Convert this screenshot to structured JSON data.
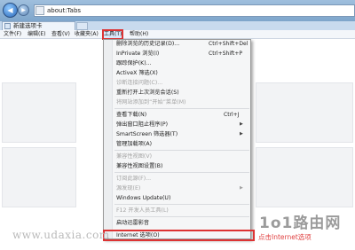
{
  "window": {
    "address": "about:Tabs",
    "tab_label": "新建选项卡"
  },
  "menubar": [
    {
      "label": "文件(F)"
    },
    {
      "label": "编辑(E)"
    },
    {
      "label": "查看(V)"
    },
    {
      "label": "收藏夹(A)"
    },
    {
      "label": "工具(T)",
      "active": true
    },
    {
      "label": "帮助(H)"
    }
  ],
  "tools_menu": {
    "items": [
      {
        "label": "删除浏览的历史记录(D)...",
        "shortcut": "Ctrl+Shift+Del",
        "enabled": true
      },
      {
        "label": "InPrivate 浏览(I)",
        "shortcut": "Ctrl+Shift+P",
        "enabled": true
      },
      {
        "label": "跟踪保护(K)...",
        "enabled": true
      },
      {
        "label": "ActiveX 筛选(X)",
        "enabled": true
      },
      {
        "label": "诊断连接问题(C)...",
        "enabled": false
      },
      {
        "label": "重新打开上次浏览会话(S)",
        "enabled": true
      },
      {
        "label": "将网站添加到“开始”菜单(M)",
        "enabled": false
      },
      {
        "label": "查看下载(N)",
        "shortcut": "Ctrl+J",
        "enabled": true
      },
      {
        "label": "弹出窗口阻止程序(P)",
        "submenu": true,
        "enabled": true
      },
      {
        "label": "SmartScreen 筛选器(T)",
        "submenu": true,
        "enabled": true
      },
      {
        "label": "管理加载项(A)",
        "enabled": true
      },
      {
        "label": "兼容性视图(V)",
        "enabled": false
      },
      {
        "label": "兼容性视图设置(B)",
        "enabled": true
      },
      {
        "label": "订阅此源(F)...",
        "enabled": false
      },
      {
        "label": "源发现(E)",
        "submenu": true,
        "enabled": false
      },
      {
        "label": "Windows Update(U)",
        "enabled": true
      },
      {
        "label": "F12 开发人员工具(L)",
        "enabled": false
      },
      {
        "label": "启动迅雷影音",
        "enabled": true
      },
      {
        "label": "Internet 选项(O)",
        "enabled": true,
        "highlighted": true
      }
    ]
  },
  "watermark": "www.udaxia.com",
  "logo": {
    "text": "1o1路由网"
  },
  "annotation": "点击Internet选项",
  "colors": {
    "highlight_border": "#dd3333",
    "annotation": "#e04141"
  }
}
